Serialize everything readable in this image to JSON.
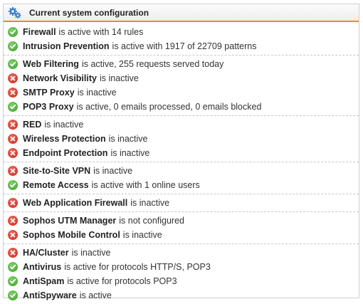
{
  "panel": {
    "title": "Current system configuration",
    "icon": "gears-icon"
  },
  "colors": {
    "accent": "#f18a1f",
    "ok": "#4caf34",
    "error": "#d9362a"
  },
  "groups": [
    [
      {
        "name": "Firewall",
        "text": "is active with 14 rules",
        "status": "ok"
      },
      {
        "name": "Intrusion Prevention",
        "text": "is active with 1917 of 22709 patterns",
        "status": "ok"
      }
    ],
    [
      {
        "name": "Web Filtering",
        "text": "is active, 255 requests served today",
        "status": "ok"
      },
      {
        "name": "Network Visibility",
        "text": "is inactive",
        "status": "error"
      },
      {
        "name": "SMTP Proxy",
        "text": "is inactive",
        "status": "error"
      },
      {
        "name": "POP3 Proxy",
        "text": "is active, 0 emails processed, 0 emails blocked",
        "status": "ok"
      }
    ],
    [
      {
        "name": "RED",
        "text": "is inactive",
        "status": "error"
      },
      {
        "name": "Wireless Protection",
        "text": "is inactive",
        "status": "error"
      },
      {
        "name": "Endpoint Protection",
        "text": "is inactive",
        "status": "error"
      }
    ],
    [
      {
        "name": "Site-to-Site VPN",
        "text": "is inactive",
        "status": "error"
      },
      {
        "name": "Remote Access",
        "text": "is active with 1 online users",
        "status": "ok"
      }
    ],
    [
      {
        "name": "Web Application Firewall",
        "text": "is inactive",
        "status": "error"
      }
    ],
    [
      {
        "name": "Sophos UTM Manager",
        "text": "is not configured",
        "status": "error"
      },
      {
        "name": "Sophos Mobile Control",
        "text": "is inactive",
        "status": "error"
      }
    ],
    [
      {
        "name": "HA/Cluster",
        "text": "is inactive",
        "status": "error"
      },
      {
        "name": "Antivirus",
        "text": "is active for protocols HTTP/S, POP3",
        "status": "ok"
      },
      {
        "name": "AntiSpam",
        "text": "is active for protocols POP3",
        "status": "ok"
      },
      {
        "name": "AntiSpyware",
        "text": "is active",
        "status": "ok"
      }
    ]
  ]
}
